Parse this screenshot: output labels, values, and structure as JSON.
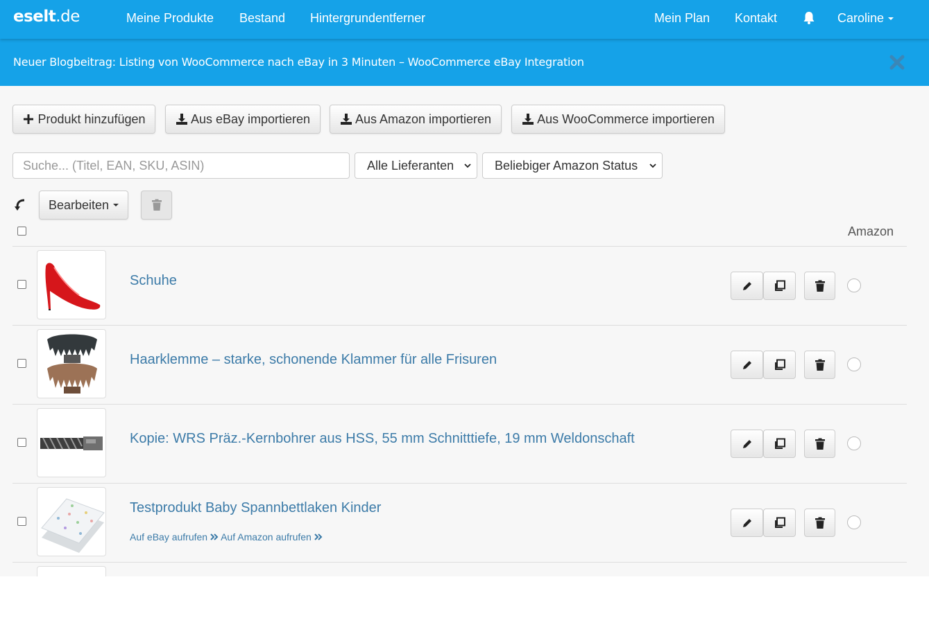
{
  "navbar": {
    "brand_bold": "eselt",
    "brand_rest": ".de",
    "links": [
      "Meine Produkte",
      "Bestand",
      "Hintergrundentferner"
    ],
    "right_links": [
      "Mein Plan",
      "Kontakt"
    ],
    "user": "Caroline"
  },
  "announcement": {
    "text": "Neuer Blogbeitrag: Listing von WooCommerce nach eBay in 3 Minuten – WooCommerce eBay Integration"
  },
  "toolbar": {
    "add_product": "Produkt hinzufügen",
    "import_ebay": "Aus eBay importieren",
    "import_amazon": "Aus Amazon importieren",
    "import_woocommerce": "Aus WooCommerce importieren"
  },
  "filters": {
    "search_placeholder": "Suche... (Titel, EAN, SKU, ASIN)",
    "supplier": "Alle Lieferanten",
    "amazon_status": "Beliebiger Amazon Status"
  },
  "bulk": {
    "edit_label": "Bearbeiten"
  },
  "table": {
    "amazon_header": "Amazon",
    "rows": [
      {
        "title": "Schuhe",
        "links": null
      },
      {
        "title": "Haarklemme – starke, schonende Klammer für alle Frisuren",
        "links": null
      },
      {
        "title": "Kopie: WRS Präz.-Kernbohrer aus HSS, 55 mm Schnitttiefe, 19 mm Weldonschaft",
        "links": null
      },
      {
        "title": "Testprodukt Baby Spannbettlaken Kinder",
        "links": {
          "ebay": "Auf eBay aufrufen",
          "amazon": "Auf Amazon aufrufen"
        }
      }
    ]
  },
  "colors": {
    "brand_blue": "#15a2e8",
    "link_blue": "#3c7ba8"
  }
}
